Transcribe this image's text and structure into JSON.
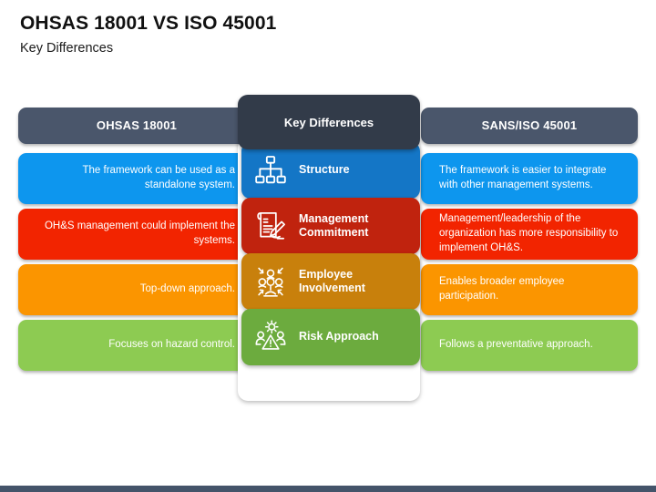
{
  "slide": {
    "title": "OHSAS 18001 VS ISO 45001",
    "subtitle": "Key Differences"
  },
  "colors": {
    "header_slate": "#4A566B",
    "center_header_navy": "#323B49",
    "side_blue": "#0D96EE",
    "side_red": "#F22400",
    "side_orange": "#FB9500",
    "side_green": "#8DCB52",
    "center_blue": "#1476C6",
    "center_red": "#C0230E",
    "center_orange": "#C8800C",
    "center_green": "#6CAB3E",
    "footer_slate": "#44546A",
    "text_white": "#FFFFFF",
    "title_black": "#111111"
  },
  "headers": {
    "left": "OHSAS 18001",
    "center": "Key Differences",
    "right": "SANS/ISO 45001"
  },
  "rows": [
    {
      "key": "structure",
      "label": "Structure",
      "icon": "hierarchy-icon",
      "left_text": "The framework can be used as a standalone system.",
      "right_text": "The framework is easier to integrate with other management systems.",
      "side_color": "#0D96EE",
      "center_color": "#1476C6"
    },
    {
      "key": "management-commitment",
      "label": "Management Commitment",
      "icon": "document-signature-icon",
      "left_text": "OH&S management could implement the systems.",
      "right_text": "Management/leadership of the organization has more responsibility to implement OH&S.",
      "side_color": "#F22400",
      "center_color": "#C0230E"
    },
    {
      "key": "employee-involvement",
      "label": "Employee Involvement",
      "icon": "people-network-icon",
      "left_text": "Top-down approach.",
      "right_text": "Enables broader employee participation.",
      "side_color": "#FB9500",
      "center_color": "#C8800C"
    },
    {
      "key": "risk-approach",
      "label": "Risk Approach",
      "icon": "risk-warning-people-icon",
      "left_text": "Focuses on hazard control.",
      "right_text": "Follows a preventative approach.",
      "side_color": "#8DCB52",
      "center_color": "#6CAB3E"
    }
  ]
}
